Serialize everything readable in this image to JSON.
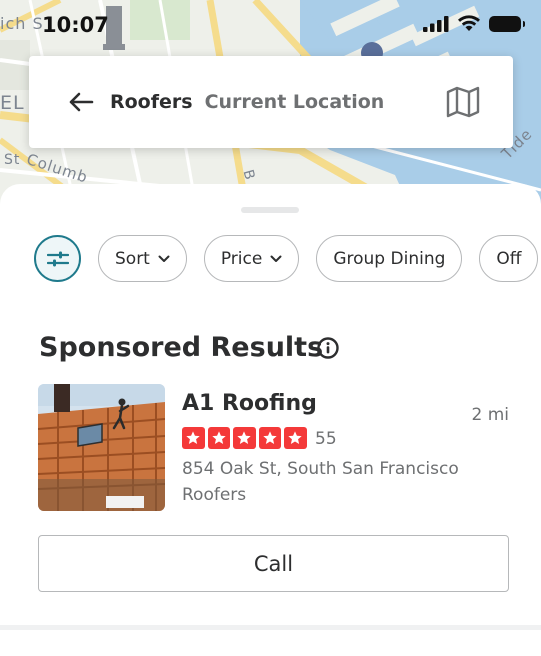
{
  "status_bar": {
    "time": "10:07"
  },
  "map": {
    "labels": [
      "ich S",
      "EL",
      "St",
      "Columb",
      "Tide",
      "B"
    ]
  },
  "search": {
    "query": "Roofers",
    "location": "Current Location"
  },
  "filters": {
    "chips": [
      {
        "label": "Sort",
        "has_dropdown": true
      },
      {
        "label": "Price",
        "has_dropdown": true
      },
      {
        "label": "Group Dining",
        "has_dropdown": false
      },
      {
        "label": "Off",
        "has_dropdown": false
      }
    ]
  },
  "results": {
    "section_title": "Sponsored Results",
    "business": {
      "name": "A1 Roofing",
      "distance": "2 mi",
      "rating": 5,
      "review_count": "55",
      "address": "854 Oak St, South San Francisco",
      "category": "Roofers",
      "call_label": "Call"
    }
  },
  "colors": {
    "accent_teal": "#1f7a8c",
    "star_red": "#f43939",
    "text_primary": "#2d2e2f",
    "text_secondary": "#6e7072",
    "water": "#a9cde8"
  }
}
